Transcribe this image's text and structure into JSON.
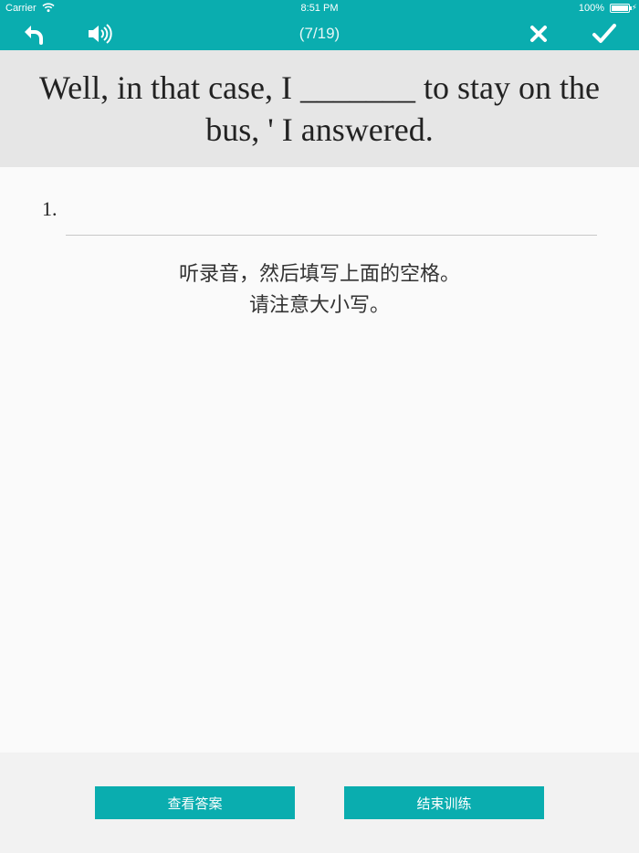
{
  "status_bar": {
    "carrier": "Carrier",
    "time": "8:51 PM",
    "battery": "100%"
  },
  "toolbar": {
    "progress": "(7/19)",
    "icons": [
      "back-icon",
      "speaker-icon",
      "close-icon",
      "check-icon"
    ]
  },
  "question": {
    "sentence": "Well, in that case, I _______ to stay on the bus, ' I answered."
  },
  "answer": {
    "number": "1.",
    "value": ""
  },
  "instructions": {
    "line1": "听录音，然后填写上面的空格。",
    "line2": "请注意大小写。"
  },
  "footer": {
    "show_answer_label": "查看答案",
    "end_training_label": "结束训练"
  },
  "colors": {
    "accent": "#0aadaf",
    "question_bg": "#e6e6e6",
    "content_bg": "#fafafa",
    "footer_bg": "#f2f2f2"
  }
}
